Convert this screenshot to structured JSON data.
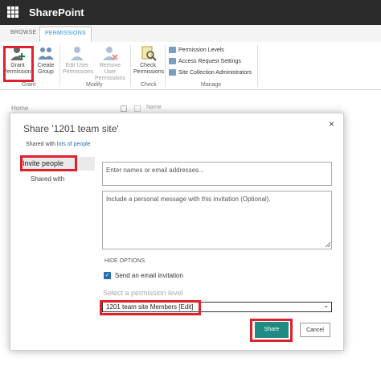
{
  "app": {
    "title": "SharePoint"
  },
  "ribbon": {
    "tabs": [
      {
        "label": "BROWSE"
      },
      {
        "label": "PERMISSIONS"
      }
    ],
    "grant_permissions": "Grant\nPermissions",
    "create_group": "Create\nGroup",
    "edit_user_permissions": "Edit User\nPermissions",
    "remove_user_permissions": "Remove User\nPermissions",
    "check_permissions": "Check\nPermissions",
    "permission_levels": "Permission Levels",
    "access_request_settings": "Access Request Settings",
    "site_collection_admins": "Site Collection Administrators",
    "groups": {
      "grant": "Grant",
      "modify": "Modify",
      "check": "Check",
      "manage": "Manage"
    }
  },
  "background": {
    "home": "Home",
    "name_col": "Name"
  },
  "dialog": {
    "title": "Share '1201 team site'",
    "close": "×",
    "shared_with_prefix": "Shared with",
    "shared_with_link": "lots of people",
    "sidebar": [
      {
        "label": "Invite people"
      },
      {
        "label": "Shared with"
      }
    ],
    "names_placeholder": "Enter names or email addresses...",
    "message_placeholder": "Include a personal message with this invitation (Optional).",
    "hide_options": "HIDE OPTIONS",
    "send_email_label": "Send an email invitation",
    "send_email_checked": true,
    "permission_label": "Select a permission level",
    "permission_selected": "1201 team site Members [Edit]",
    "share_button": "Share",
    "cancel_button": "Cancel"
  },
  "colors": {
    "highlight": "#e0202a",
    "share_button": "#1f8c84",
    "suitebar": "#2b2b2b",
    "accent": "#2a8dd4"
  }
}
